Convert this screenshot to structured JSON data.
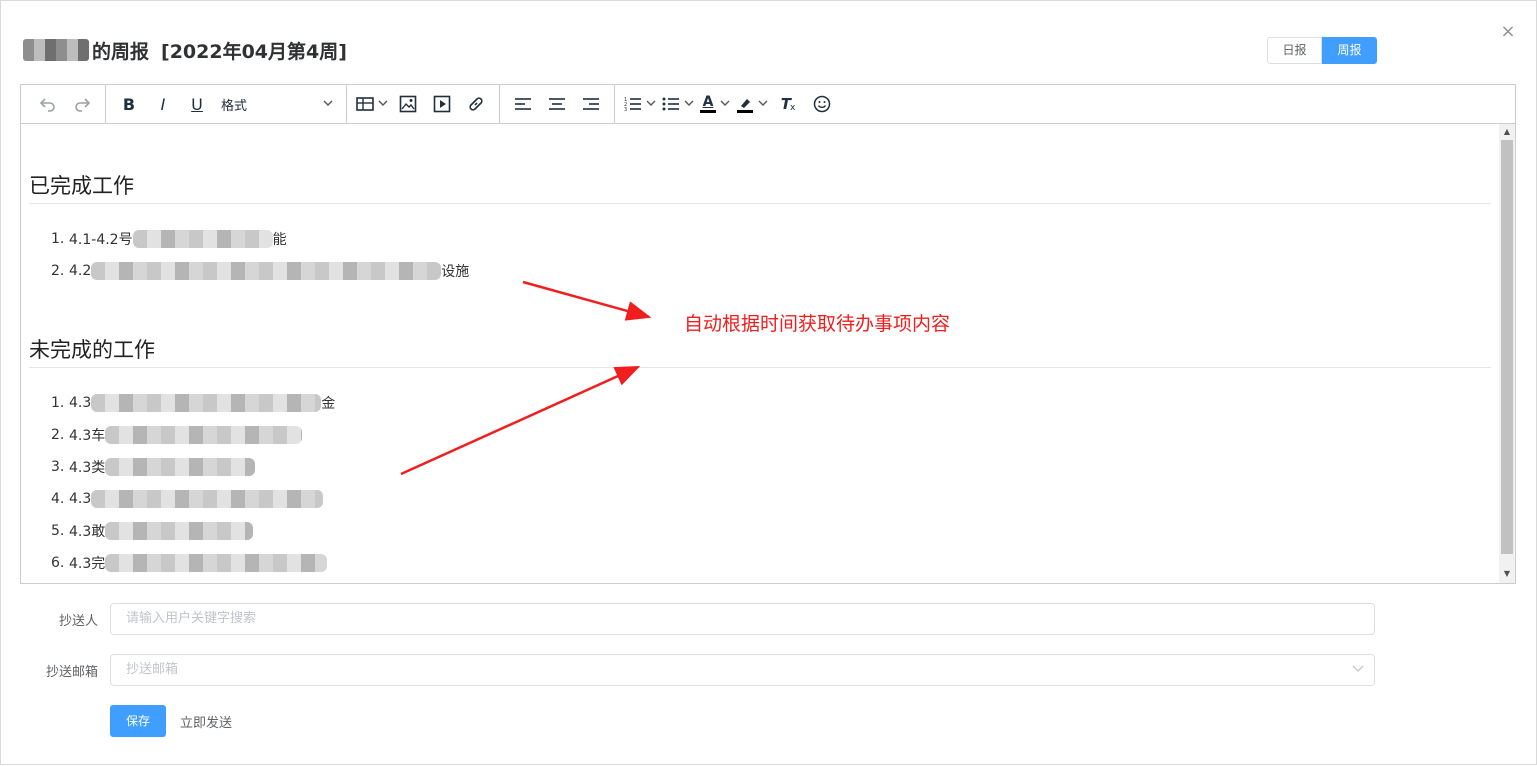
{
  "dialog": {
    "title_suffix": "的周报",
    "title_week": "[2022年04月第4周]",
    "close_glyph": "×",
    "modes": [
      {
        "label": "日报",
        "active": false
      },
      {
        "label": "周报",
        "active": true
      }
    ]
  },
  "toolbar": {
    "undo_icon": "undo-icon",
    "redo_icon": "redo-icon",
    "bold": "B",
    "italic": "I",
    "underline": "U",
    "format_label": "格式",
    "table_icon": "table-icon",
    "image_icon": "image-icon",
    "media_icon": "media-icon",
    "link_icon": "link-icon",
    "align_icons": [
      "align-left-icon",
      "align-center-icon",
      "align-right-icon"
    ],
    "list_icons": [
      "numbered-list-icon",
      "bullet-list-icon"
    ],
    "text_color_glyph": "A",
    "highlight_icon": "highlight-icon",
    "clear_format_glyph": "T",
    "emoji_icon": "emoji-icon"
  },
  "content": {
    "section1_heading": "已完成工作",
    "section1_items": [
      {
        "num": "1.",
        "prefix": "4.1-4.2号",
        "suffix": "能"
      },
      {
        "num": "2.",
        "prefix": "4.2",
        "suffix": "设施"
      }
    ],
    "section2_heading": "未完成的工作",
    "section2_items": [
      {
        "num": "1.",
        "prefix": "4.3",
        "suffix": "金"
      },
      {
        "num": "2.",
        "prefix": "4.3车",
        "suffix": ""
      },
      {
        "num": "3.",
        "prefix": "4.3类",
        "suffix": ""
      },
      {
        "num": "4.",
        "prefix": "4.3",
        "suffix": ""
      },
      {
        "num": "5.",
        "prefix": "4.3敢",
        "suffix": ""
      },
      {
        "num": "6.",
        "prefix": "4.3完",
        "suffix": ""
      }
    ]
  },
  "annotation": {
    "text": "自动根据时间获取待办事项内容",
    "color": "#f01e1e"
  },
  "form": {
    "cc_label": "抄送人",
    "cc_placeholder": "请输入用户关键字搜索",
    "email_label": "抄送邮箱",
    "email_placeholder": "抄送邮箱",
    "save_label": "保存",
    "send_label": "立即发送"
  },
  "colors": {
    "primary": "#409eff",
    "border": "#dcdfe6"
  }
}
